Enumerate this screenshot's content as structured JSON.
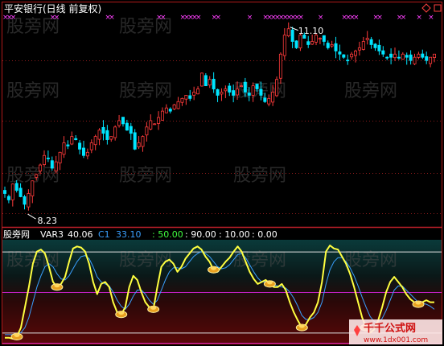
{
  "header": {
    "stock_title": "平安银行(日线 前复权)",
    "title_color": "#ffffff"
  },
  "watermark": {
    "text": "股旁网",
    "site_logo": "千千公式网",
    "site_url": "www.1dx001.com"
  },
  "colors": {
    "up_candle": "#ff3b3b",
    "down_candle": "#00e5ff",
    "grid": "#8b1a1a",
    "var3_line": "#ffff40",
    "c1_line": "#3aa0ff",
    "level_line": "#c020c0",
    "panel_border": "#c0202a",
    "markers": "#ff40ff"
  },
  "chart_data": [
    {
      "type": "candlestick",
      "title": "平安银行(日线 前复权)",
      "annotations": [
        {
          "text": "8.23",
          "kind": "low"
        },
        {
          "text": "11.10",
          "kind": "high"
        }
      ],
      "candle_count": 110,
      "price_range": [
        8.0,
        11.2
      ],
      "close_path": [
        8.4,
        8.3,
        8.55,
        8.45,
        8.35,
        8.23,
        8.4,
        8.6,
        8.7,
        8.85,
        9.0,
        8.95,
        8.8,
        8.9,
        9.05,
        9.2,
        9.15,
        9.3,
        9.25,
        9.1,
        9.0,
        9.05,
        9.2,
        9.3,
        9.4,
        9.35,
        9.25,
        9.3,
        9.45,
        9.55,
        9.5,
        9.4,
        9.35,
        9.1,
        9.2,
        9.3,
        9.45,
        9.55,
        9.5,
        9.6,
        9.7,
        9.75,
        9.7,
        9.8,
        9.85,
        9.9,
        9.95,
        9.9,
        10.0,
        10.05,
        10.3,
        10.1,
        10.2,
        10.05,
        9.95,
        10.0,
        10.05,
        10.0,
        9.95,
        10.05,
        10.1,
        10.0,
        9.95,
        10.1,
        10.05,
        9.95,
        9.85,
        9.9,
        10.0,
        10.2,
        10.6,
        10.9,
        11.0,
        10.8,
        10.7,
        10.9,
        10.85,
        10.75,
        10.8,
        10.9,
        10.85,
        10.8,
        10.7,
        10.75,
        10.65,
        10.6,
        10.55,
        10.5,
        10.6,
        10.65,
        10.7,
        10.8,
        10.85,
        10.75,
        10.7,
        10.65,
        10.6,
        10.55,
        10.55,
        10.6,
        10.55,
        10.6,
        10.55,
        10.5,
        10.55,
        10.6,
        10.55,
        10.5,
        10.55,
        10.6
      ]
    },
    {
      "type": "line",
      "legend_title": "股旁网",
      "series": [
        {
          "name": "VAR3",
          "last_value_text": "40.06",
          "color": "#ffff40"
        },
        {
          "name": "C1",
          "last_value_text": "33.10",
          "color": "#3aa0ff"
        }
      ],
      "levels_text": [
        ": 50.00",
        ": 90.00",
        ": 10.00",
        ": 0.00"
      ],
      "levels": [
        50,
        90,
        10,
        0
      ],
      "ylim": [
        0,
        100
      ],
      "var3": [
        5,
        5,
        4,
        6,
        15,
        35,
        55,
        78,
        90,
        92,
        88,
        75,
        60,
        55,
        58,
        65,
        80,
        93,
        95,
        94,
        90,
        78,
        60,
        48,
        58,
        60,
        55,
        40,
        30,
        28,
        35,
        55,
        66,
        62,
        50,
        40,
        35,
        33,
        55,
        75,
        80,
        82,
        78,
        70,
        75,
        83,
        88,
        93,
        95,
        92,
        85,
        80,
        72,
        70,
        75,
        80,
        84,
        90,
        95,
        90,
        80,
        70,
        63,
        58,
        60,
        62,
        58,
        55,
        55,
        58,
        52,
        40,
        30,
        22,
        15,
        18,
        25,
        30,
        40,
        60,
        90,
        96,
        93,
        92,
        85,
        78,
        68,
        55,
        40,
        25,
        15,
        10,
        13,
        22,
        35,
        50,
        60,
        65,
        60,
        55,
        48,
        43,
        40,
        38,
        40,
        42,
        40,
        40
      ],
      "c1": [
        8,
        8,
        8,
        9,
        10,
        15,
        25,
        40,
        55,
        66,
        75,
        78,
        75,
        68,
        63,
        62,
        66,
        73,
        80,
        85,
        86,
        83,
        75,
        65,
        60,
        58,
        56,
        50,
        42,
        36,
        33,
        38,
        46,
        52,
        52,
        48,
        42,
        38,
        42,
        52,
        62,
        70,
        74,
        74,
        73,
        75,
        80,
        85,
        88,
        90,
        88,
        85,
        80,
        75,
        73,
        74,
        77,
        82,
        87,
        88,
        84,
        77,
        70,
        64,
        60,
        60,
        59,
        57,
        56,
        55,
        54,
        50,
        44,
        36,
        27,
        23,
        23,
        25,
        30,
        40,
        58,
        72,
        80,
        84,
        84,
        80,
        74,
        66,
        56,
        45,
        35,
        26,
        21,
        20,
        24,
        32,
        42,
        52,
        56,
        56,
        52,
        48,
        44,
        40,
        39,
        38,
        36,
        33
      ]
    }
  ]
}
